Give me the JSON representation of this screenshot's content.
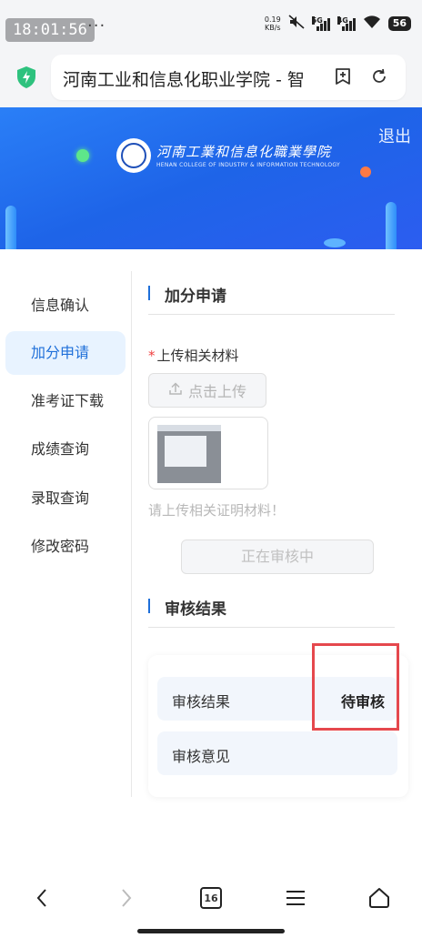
{
  "status_bar": {
    "time": "18:01:56",
    "overflow": "···",
    "net_speed": "0.19",
    "net_speed_unit": "KB/s",
    "net1": "5G",
    "net2": "4G",
    "battery": "56"
  },
  "browser": {
    "url_title": "河南工业和信息化职业学院 - 智",
    "tab_count": "16"
  },
  "banner": {
    "logout": "退出",
    "school_name_cn": "河南工業和信息化職業學院",
    "school_name_en": "HENAN COLLEGE OF INDUSTRY & INFORMATION TECHNOLOGY"
  },
  "sidebar": {
    "items": [
      {
        "label": "信息确认"
      },
      {
        "label": "加分申请"
      },
      {
        "label": "准考证下载"
      },
      {
        "label": "成绩查询"
      },
      {
        "label": "录取查询"
      },
      {
        "label": "修改密码"
      }
    ],
    "active_index": 1
  },
  "apply": {
    "title": "加分申请",
    "required_mark": "*",
    "upload_label": "上传相关材料",
    "upload_button": "点击上传",
    "hint": "请上传相关证明材料！",
    "review_button": "正在审核中"
  },
  "result": {
    "title": "审核结果",
    "rows": [
      {
        "label": "审核结果",
        "value": "待审核"
      },
      {
        "label": "审核意见",
        "value": ""
      }
    ]
  },
  "colors": {
    "accent": "#1e6fd9",
    "banner": "#1e64e8",
    "highlight": "#e5484d"
  }
}
